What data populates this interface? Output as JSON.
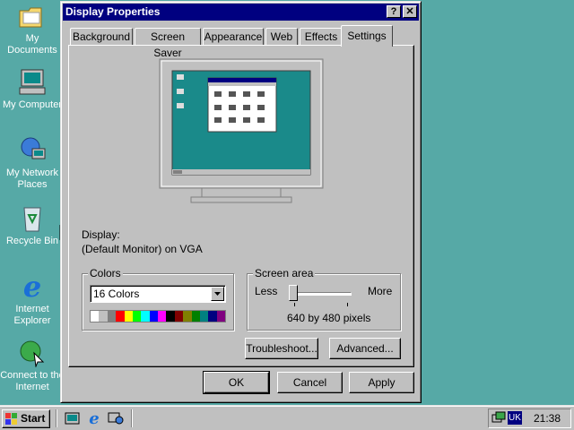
{
  "desktop": {
    "icons": [
      {
        "label": "My Documents"
      },
      {
        "label": "My Computer"
      },
      {
        "label": "My Network Places"
      },
      {
        "label": "Recycle Bin"
      },
      {
        "label": "Internet Explorer"
      },
      {
        "label": "Connect to the Internet"
      }
    ]
  },
  "window": {
    "title": "Display Properties",
    "help_label": "?",
    "close_label": "✕",
    "tabs": [
      {
        "label": "Background"
      },
      {
        "label": "Screen Saver"
      },
      {
        "label": "Appearance"
      },
      {
        "label": "Web"
      },
      {
        "label": "Effects"
      },
      {
        "label": "Settings",
        "active": true
      }
    ],
    "display_label": "Display:",
    "display_value": "(Default Monitor) on VGA",
    "colors": {
      "group_label": "Colors",
      "selected": "16 Colors",
      "palette": [
        "#ffffff",
        "#c0c0c0",
        "#808080",
        "#ff0000",
        "#ffff00",
        "#00ff00",
        "#00ffff",
        "#0000ff",
        "#ff00ff",
        "#000000",
        "#800000",
        "#808000",
        "#008000",
        "#008080",
        "#000080",
        "#800080"
      ]
    },
    "screen_area": {
      "group_label": "Screen area",
      "less_label": "Less",
      "more_label": "More",
      "resolution": "640 by 480 pixels",
      "slider_level": 0
    },
    "troubleshoot_label": "Troubleshoot...",
    "advanced_label": "Advanced...",
    "ok_label": "OK",
    "cancel_label": "Cancel",
    "apply_label": "Apply"
  },
  "taskbar": {
    "start_label": "Start",
    "language": "UK",
    "clock": "21:38"
  },
  "colors": {
    "desktop": "#56a9a6",
    "title_bar": "#000080",
    "face": "#c0c0c0"
  }
}
